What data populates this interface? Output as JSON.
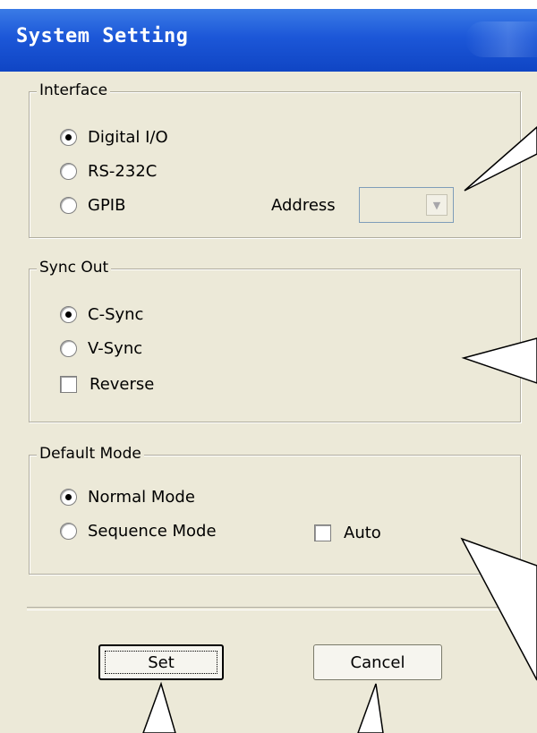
{
  "window": {
    "title": "System Setting"
  },
  "interface": {
    "legend": "Interface",
    "options": [
      "Digital I/O",
      "RS-232C",
      "GPIB"
    ],
    "selected_index": 0,
    "address_label": "Address",
    "address_value": ""
  },
  "sync_out": {
    "legend": "Sync Out",
    "options": [
      "C-Sync",
      "V-Sync"
    ],
    "selected_index": 0,
    "reverse_label": "Reverse",
    "reverse_checked": false
  },
  "default_mode": {
    "legend": "Default Mode",
    "options": [
      "Normal Mode",
      "Sequence Mode"
    ],
    "selected_index": 0,
    "auto_label": "Auto",
    "auto_checked": false
  },
  "buttons": {
    "set_label": "Set",
    "cancel_label": "Cancel"
  },
  "colors": {
    "titlebar": "#1c57d8",
    "face": "#ece9d8",
    "group_border": "#b0ad9f"
  }
}
